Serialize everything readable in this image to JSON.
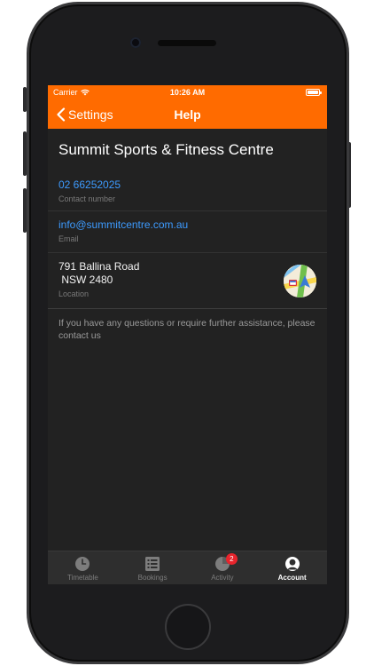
{
  "status_bar": {
    "carrier": "Carrier",
    "time": "10:26 AM"
  },
  "nav": {
    "back_label": "Settings",
    "title": "Help"
  },
  "organization": {
    "name": "Summit Sports & Fitness Centre"
  },
  "contact": {
    "phone": {
      "value": "02 66252025",
      "caption": "Contact number"
    },
    "email": {
      "value": "info@summitcentre.com.au",
      "caption": "Email"
    },
    "location": {
      "line1": "791 Ballina Road",
      "line2": " NSW 2480",
      "caption": "Location"
    }
  },
  "help_note": "If you have any questions or require further assistance, please contact us",
  "tabs": [
    {
      "label": "Timetable",
      "icon": "clock-icon",
      "active": false
    },
    {
      "label": "Bookings",
      "icon": "list-icon",
      "active": false
    },
    {
      "label": "Activity",
      "icon": "pie-chart-icon",
      "active": false,
      "badge": "2"
    },
    {
      "label": "Account",
      "icon": "person-icon",
      "active": true
    }
  ],
  "colors": {
    "brand": "#ff6b00",
    "link": "#3d9bff",
    "background": "#222222",
    "badge": "#e8242c"
  }
}
